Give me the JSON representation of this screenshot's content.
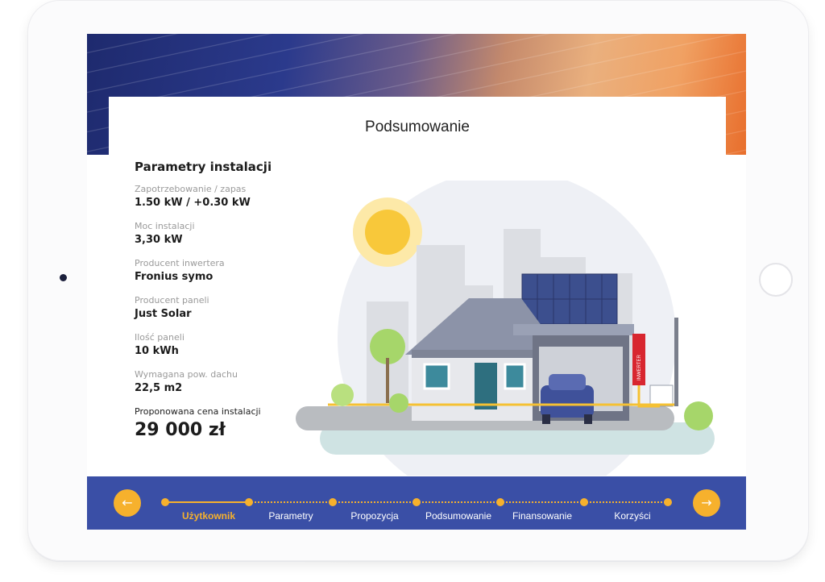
{
  "page": {
    "title": "Podsumowanie"
  },
  "params": {
    "title": "Parametry instalacji",
    "items": [
      {
        "label": "Zapotrzebowanie / zapas",
        "value": "1.50 kW / +0.30 kW"
      },
      {
        "label": "Moc instalacji",
        "value": "3,30 kW"
      },
      {
        "label": "Producent inwertera",
        "value": "Fronius symo"
      },
      {
        "label": "Producent paneli",
        "value": "Just Solar"
      },
      {
        "label": "Ilość paneli",
        "value": "10  kWh"
      },
      {
        "label": "Wymagana pow. dachu",
        "value": "22,5 m2"
      }
    ],
    "price_label": "Proponowana cena instalacji",
    "price_value": "29 000 zł"
  },
  "illustration": {
    "inverter_label": "INWERTER"
  },
  "stepper": {
    "prev_icon": "arrow-left-icon",
    "next_icon": "arrow-right-icon",
    "prev_glyph": "←",
    "next_glyph": "→",
    "steps": [
      "Użytkownik",
      "Parametry",
      "Propozycja",
      "Podsumowanie",
      "Finansowanie",
      "Korzyści"
    ],
    "active_index": 0
  },
  "colors": {
    "accent": "#f6b12d",
    "bar": "#3a4fa6",
    "text": "#1c1c1c"
  }
}
